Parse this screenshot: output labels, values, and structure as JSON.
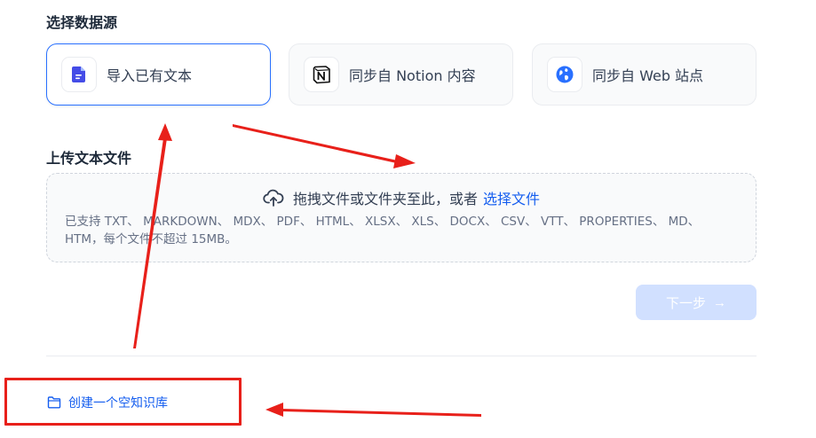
{
  "source_section": {
    "title": "选择数据源",
    "cards": [
      {
        "label": "导入已有文本",
        "icon": "document-icon",
        "selected": true
      },
      {
        "label": "同步自 Notion 内容",
        "icon": "notion-icon",
        "selected": false
      },
      {
        "label": "同步自 Web 站点",
        "icon": "globe-icon",
        "selected": false
      }
    ]
  },
  "upload_section": {
    "title": "上传文本文件",
    "drop_text": "拖拽文件或文件夹至此，或者",
    "select_link": "选择文件",
    "hint": "已支持 TXT、 MARKDOWN、 MDX、 PDF、 HTML、 XLSX、 XLS、 DOCX、 CSV、 VTT、 PROPERTIES、 MD、 HTM，每个文件不超过 15MB。"
  },
  "next_button": {
    "label": "下一步",
    "icon": "arrow-right-icon",
    "enabled": false
  },
  "create_empty": {
    "label": "创建一个空知识库",
    "icon": "folder-icon"
  },
  "colors": {
    "accent": "#155eef",
    "selected_border": "#2970ff",
    "disabled_button": "#d1e0ff",
    "annotation": "#e8201a"
  }
}
